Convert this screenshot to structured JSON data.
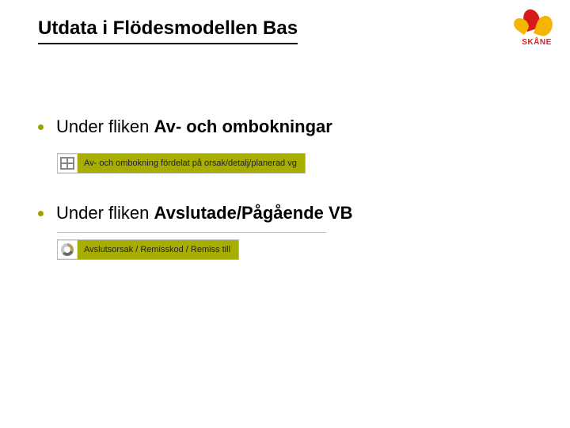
{
  "title": "Utdata i Flödesmodellen Bas",
  "logo": {
    "text": "SKÅNE"
  },
  "bullets": [
    {
      "prefix": "Under fliken ",
      "tab": "Av- och ombokningar",
      "row_label": "Av- och ombokning fördelat på orsak/detalj/planerad vg",
      "icon": "grid"
    },
    {
      "prefix": "Under fliken ",
      "tab": "Avslutade/Pågående VB",
      "row_label": "Avslutsorsak / Remisskod / Remiss till",
      "icon": "pie"
    }
  ]
}
